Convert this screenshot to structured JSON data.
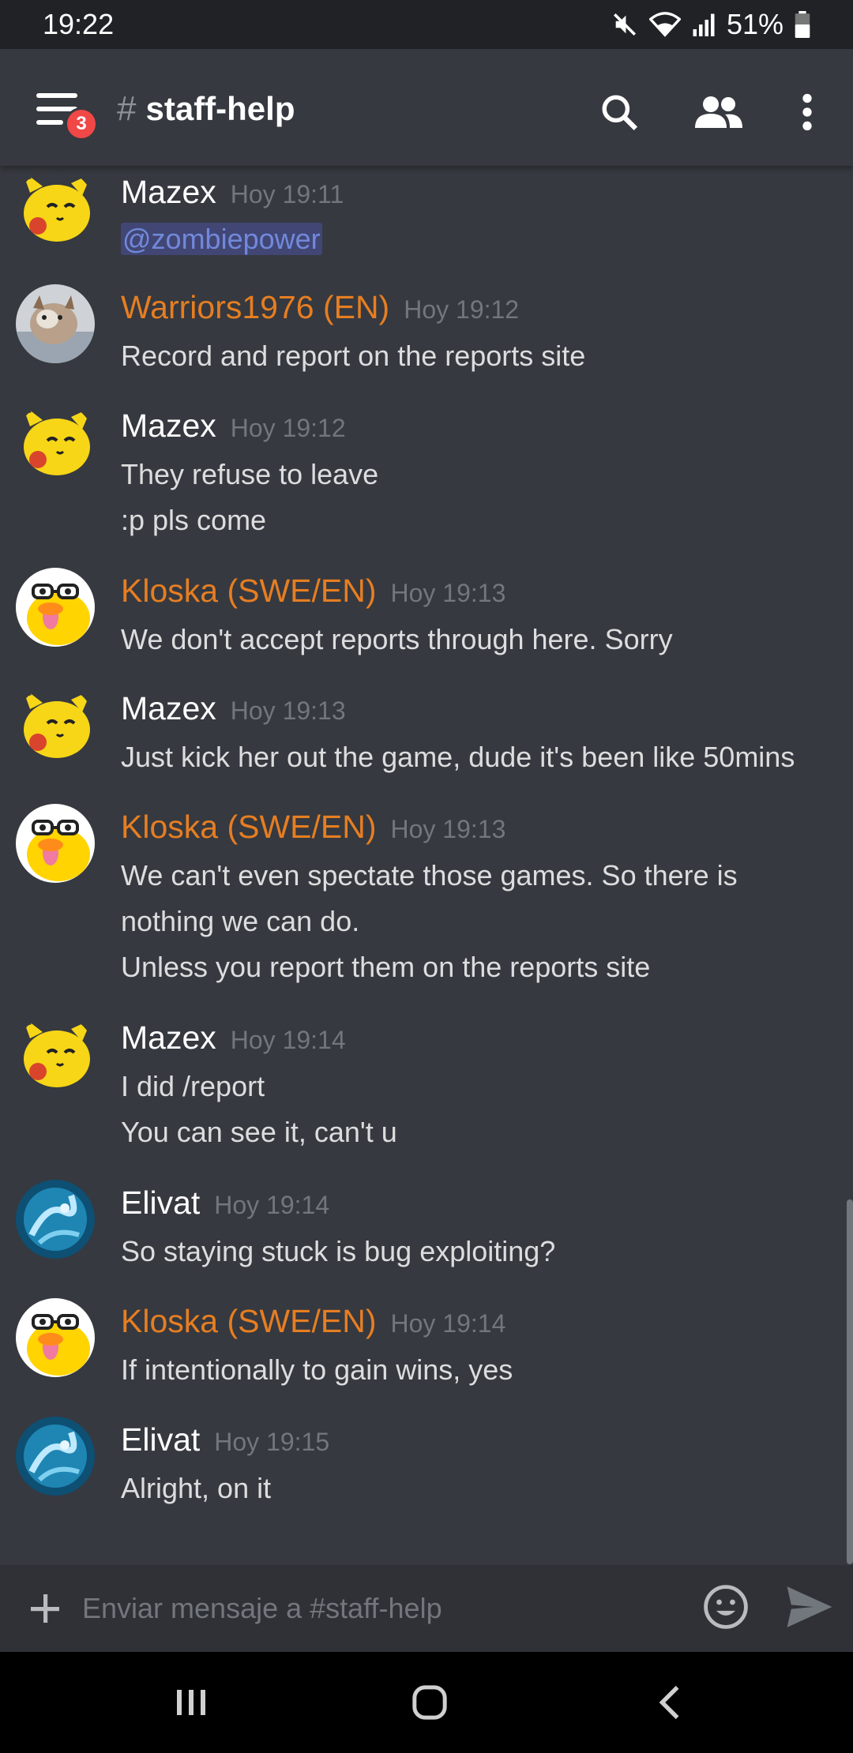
{
  "status": {
    "time": "19:22",
    "battery": "51%"
  },
  "header": {
    "hash": "#",
    "channel": "staff-help",
    "badge": "3"
  },
  "messages": [
    {
      "author": "Mazex",
      "time": "Hoy 19:11",
      "lines": [
        "@zombiepower"
      ],
      "avatar": "pikachu-avatar",
      "color": "#ffffff"
    },
    {
      "author": "Warriors1976 (EN)",
      "time": "Hoy 19:12",
      "lines": [
        "Record and report on the reports site"
      ],
      "avatar": "photo-avatar",
      "color": "#e67e22"
    },
    {
      "author": "Mazex",
      "time": "Hoy 19:12",
      "lines": [
        "They refuse to leave",
        ":p pls come"
      ],
      "avatar": "pikachu-avatar",
      "color": "#ffffff"
    },
    {
      "author": "Kloska (SWE/EN)",
      "time": "Hoy 19:13",
      "lines": [
        "We don't accept reports through here. Sorry"
      ],
      "avatar": "duck-avatar",
      "color": "#e67e22"
    },
    {
      "author": "Mazex",
      "time": "Hoy 19:13",
      "lines": [
        "Just kick her out the game, dude it's been like 50mins"
      ],
      "avatar": "pikachu-avatar",
      "color": "#ffffff"
    },
    {
      "author": "Kloska (SWE/EN)",
      "time": "Hoy 19:13",
      "lines": [
        "We can't even spectate those games. So there is",
        "nothing we can do.",
        "Unless you report them on the reports site"
      ],
      "avatar": "duck-avatar",
      "color": "#e67e22"
    },
    {
      "author": "Mazex",
      "time": "Hoy 19:14",
      "lines": [
        "I did /report",
        "You can see it, can't u"
      ],
      "avatar": "pikachu-avatar",
      "color": "#ffffff"
    },
    {
      "author": "Elivat",
      "time": "Hoy 19:14",
      "lines": [
        "So staying stuck is bug exploiting?"
      ],
      "avatar": "ocean-avatar",
      "color": "#ffffff"
    },
    {
      "author": "Kloska (SWE/EN)",
      "time": "Hoy 19:14",
      "lines": [
        "If intentionally to gain wins, yes"
      ],
      "avatar": "duck-avatar",
      "color": "#e67e22"
    },
    {
      "author": "Elivat",
      "time": "Hoy 19:15",
      "lines": [
        "Alright, on it"
      ],
      "avatar": "ocean-avatar",
      "color": "#ffffff"
    }
  ],
  "input": {
    "placeholder": "Enviar mensaje a #staff-help"
  },
  "colors": {
    "background": "#36393f",
    "input_bar": "#2f3136",
    "status_bar": "#202225",
    "mention": "#7289da",
    "role_orange": "#e67e22",
    "badge_red": "#f04747"
  }
}
